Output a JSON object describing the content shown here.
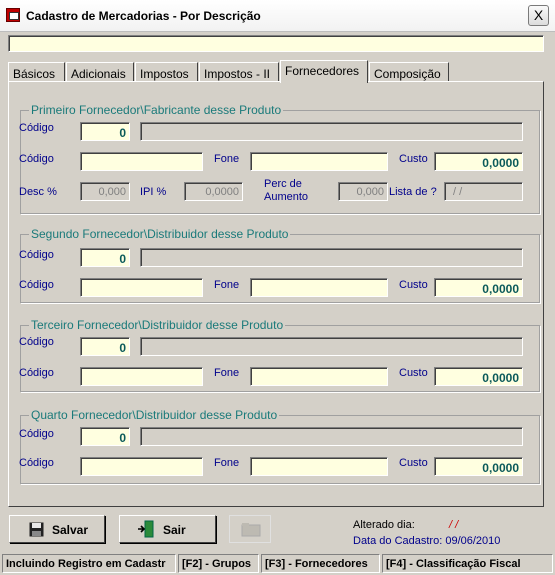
{
  "window": {
    "title": "Cadastro de Mercadorias - Por Descrição",
    "close_label": "X"
  },
  "tabs": [
    "Básicos",
    "Adicionais",
    "Impostos",
    "Impostos - II",
    "Fornecedores",
    "Composição"
  ],
  "labels": {
    "codigo": "Código",
    "fone": "Fone",
    "custo": "Custo",
    "desc": "Desc %",
    "ipi": "IPI %",
    "perc_line1": "Perc de",
    "perc_line2": "Aumento",
    "lista": "Lista de ?"
  },
  "groups": [
    {
      "title": "Primeiro Fornecedor\\Fabricante desse Produto",
      "code": "0",
      "cost": "0,0000",
      "desc": "0,000",
      "ipi": "0,0000",
      "perc": "0,000",
      "lista": "/  /"
    },
    {
      "title": "Segundo Fornecedor\\Distribuidor desse Produto",
      "code": "0",
      "cost": "0,0000"
    },
    {
      "title": "Terceiro Fornecedor\\Distribuidor desse Produto",
      "code": "0",
      "cost": "0,0000"
    },
    {
      "title": "Quarto Fornecedor\\Distribuidor desse Produto",
      "code": "0",
      "cost": "0,0000"
    }
  ],
  "buttons": {
    "save": "Salvar",
    "exit": "Sair"
  },
  "info": {
    "altered_label": "Alterado dia:",
    "altered_value": "/  /",
    "created": "Data do Cadastro: 09/06/2010"
  },
  "status": [
    "Incluindo Registro em Cadastr",
    "[F2] - Grupos",
    "[F3] - Fornecedores",
    "[F4] - Classificação Fiscal"
  ],
  "colors": {
    "field_bg": "#ffffe0",
    "label": "#00008b",
    "group_title": "#1a7a7a",
    "altered_value": "#cc0000"
  }
}
